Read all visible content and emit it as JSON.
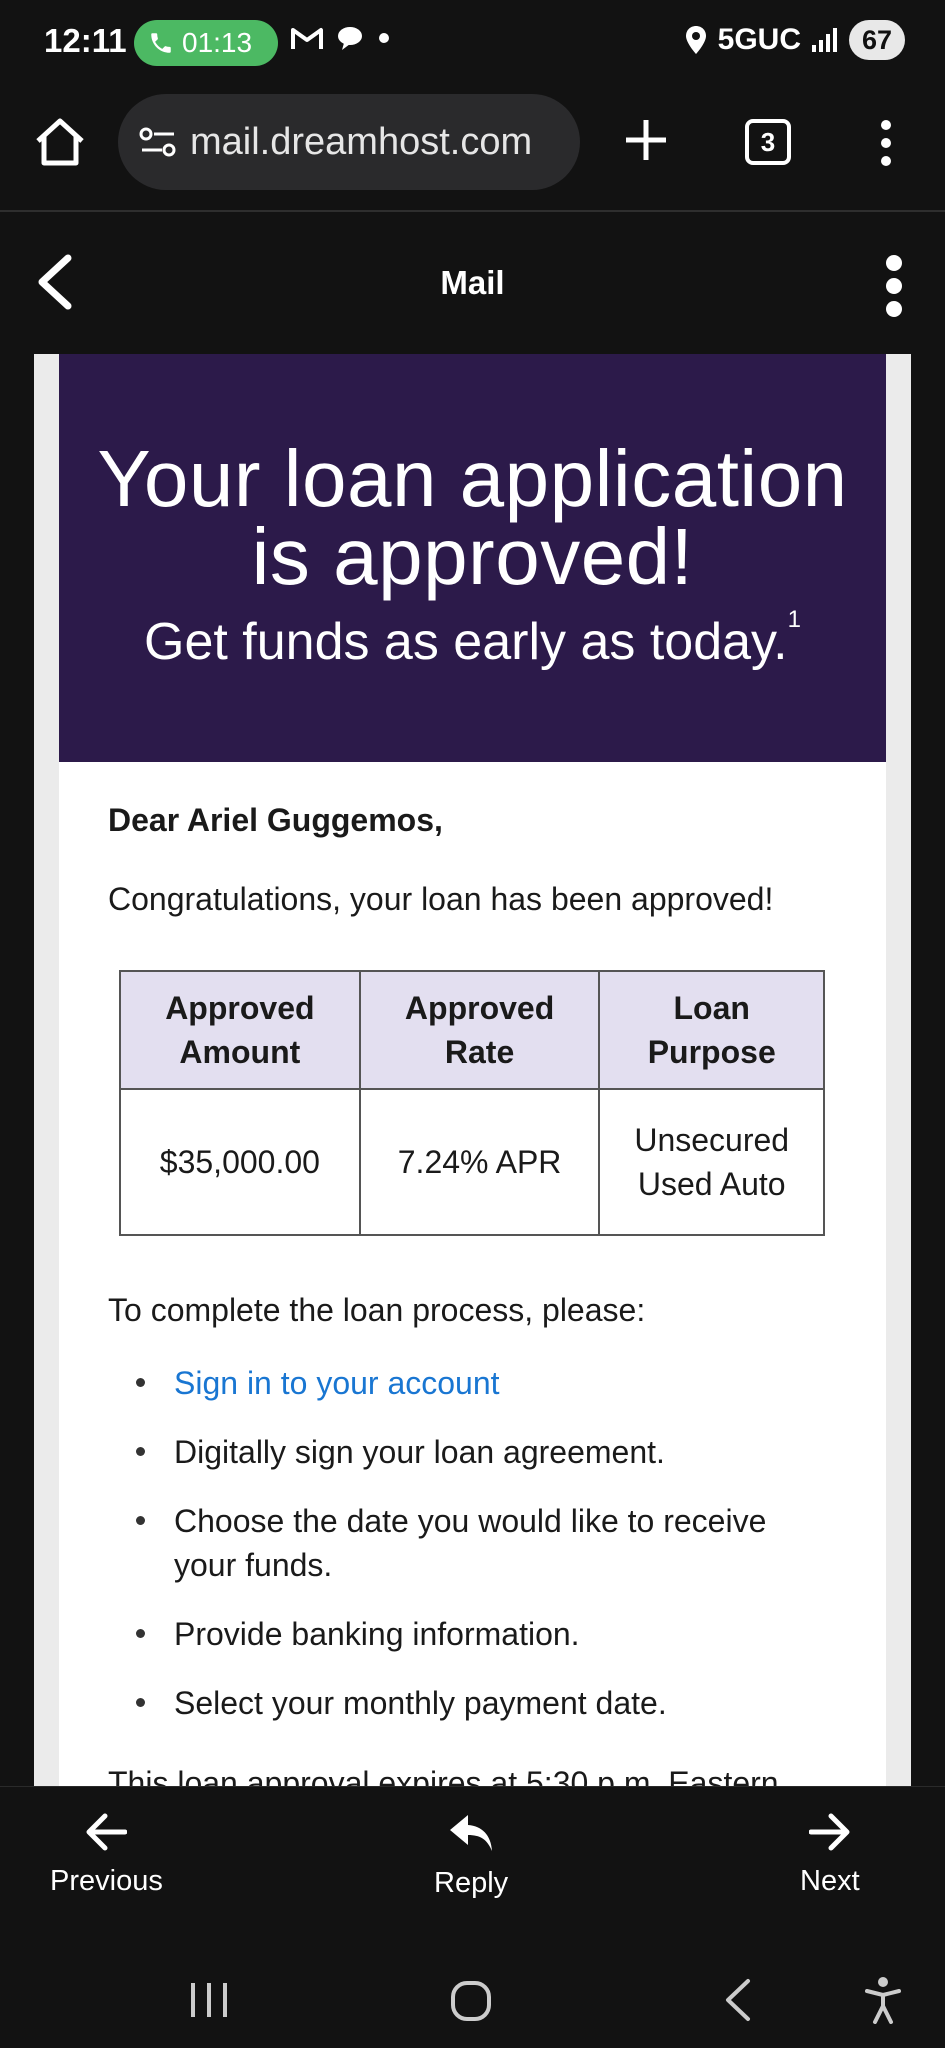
{
  "status_bar": {
    "time": "12:11",
    "call_timer": "01:13",
    "network": "5GUC",
    "battery": "67"
  },
  "browser": {
    "url": "mail.dreamhost.com",
    "tab_count": "3"
  },
  "app_bar": {
    "title": "Mail"
  },
  "email": {
    "hero_title_line1": "Your loan application",
    "hero_title_line2": "is approved!",
    "hero_subtitle": "Get funds as early as today.",
    "hero_footnote": "1",
    "greeting": "Dear Ariel Guggemos,",
    "congrats": "Congratulations, your loan has been approved!",
    "table": {
      "headers": [
        {
          "line1": "Approved",
          "line2": "Amount"
        },
        {
          "line1": "Approved",
          "line2": "Rate"
        },
        {
          "line1": "Loan",
          "line2": "Purpose"
        }
      ],
      "values": {
        "amount": "$35,000.00",
        "rate": "7.24% APR",
        "purpose_line1": "Unsecured",
        "purpose_line2": "Used Auto"
      }
    },
    "complete_intro": "To complete the loan process, please:",
    "steps": [
      "Sign in to your account",
      "Digitally sign your loan agreement.",
      "Choose the date you would like to receive your funds.",
      "Provide banking information.",
      "Select your monthly payment date."
    ],
    "expires_text": "This loan approval expires at 5:30 p.m. Eastern"
  },
  "bottom_nav": {
    "previous": "Previous",
    "reply": "Reply",
    "next": "Next"
  },
  "colors": {
    "hero_bg": "#2c1a4a",
    "table_header_bg": "#e3dff0",
    "link": "#1976d2",
    "call_pill": "#4cb963"
  }
}
